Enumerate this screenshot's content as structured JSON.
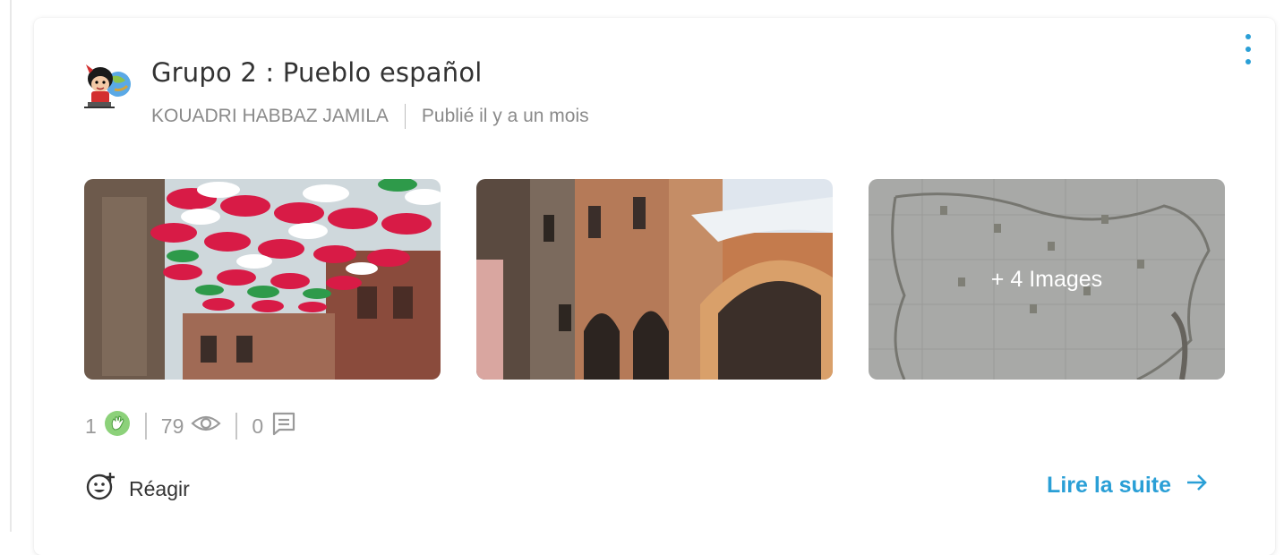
{
  "post": {
    "title": "Grupo 2 : Pueblo español",
    "author": "KOUADRI HABBAZ JAMILA",
    "published": "Publié il y a un mois"
  },
  "gallery": {
    "more_label": "+ 4 Images"
  },
  "stats": {
    "reactions": "1",
    "views": "79",
    "comments": "0"
  },
  "actions": {
    "react_label": "Réagir",
    "read_more_label": "Lire la suite"
  },
  "icons": {
    "menu": "kebab-menu-icon",
    "reaction": "clap-icon",
    "views": "eye-icon",
    "comments": "comment-icon",
    "react": "smiley-add-icon",
    "read_more": "arrow-right-icon"
  },
  "colors": {
    "accent": "#2a9fd6",
    "text_primary": "#333333",
    "text_secondary": "#8a8a8a"
  }
}
